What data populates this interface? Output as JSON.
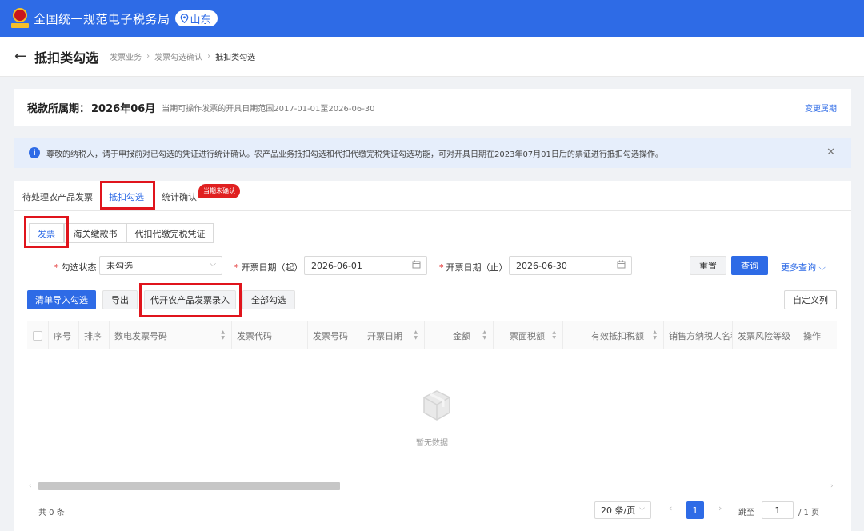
{
  "header": {
    "site_title": "全国统一规范电子税务局",
    "region": "山东"
  },
  "page": {
    "title": "抵扣类勾选",
    "breadcrumbs": [
      "发票业务",
      "发票勾选确认",
      "抵扣类勾选"
    ]
  },
  "period": {
    "label": "税款所属期：",
    "value": "2026年06月",
    "range_text": "当期可操作发票的开具日期范围2017-01-01至2026-06-30",
    "change_label": "变更属期"
  },
  "notice": {
    "text": "尊敬的纳税人，请于申报前对已勾选的凭证进行统计确认。农产品业务抵扣勾选和代扣代缴完税凭证勾选功能，可对开具日期在2023年07月01日后的票证进行抵扣勾选操作。"
  },
  "tabs": {
    "items": [
      "待处理农产品发票",
      "抵扣勾选",
      "统计确认"
    ],
    "active_index": 1,
    "badge": "当期未确认"
  },
  "subtabs": {
    "items": [
      "发票",
      "海关缴款书",
      "代扣代缴完税凭证"
    ],
    "active_index": 0
  },
  "filters": {
    "status_label": "勾选状态",
    "status_value": "未勾选",
    "start_label": "开票日期（起）",
    "start_value": "2026-06-01",
    "end_label": "开票日期（止）",
    "end_value": "2026-06-30",
    "reset_label": "重置",
    "query_label": "查询",
    "more_label": "更多查询"
  },
  "toolbar": {
    "import_label": "清单导入勾选",
    "export_label": "导出",
    "agri_entry_label": "代开农产品发票录入",
    "select_all_label": "全部勾选",
    "custom_columns_label": "自定义列"
  },
  "table": {
    "columns": [
      "序号",
      "排序",
      "数电发票号码",
      "发票代码",
      "发票号码",
      "开票日期",
      "金额",
      "票面税额",
      "有效抵扣税额",
      "销售方纳税人名称",
      "发票风险等级",
      "操作"
    ],
    "empty_text": "暂无数据",
    "scroll_position": 0.0
  },
  "pagination": {
    "total_text": "共 0 条",
    "page_size": "20 条/页",
    "current_page": "1",
    "jump_label": "跳至",
    "jump_value": "1",
    "pages_text": "/ 1 页"
  },
  "colors": {
    "brand": "#2e6be6",
    "highlight": "#e0141c",
    "badge": "#e02020"
  },
  "icons": [
    "emblem-icon",
    "location-pin-icon",
    "back-arrow-icon",
    "info-icon",
    "close-icon",
    "calendar-icon",
    "chevron-down-icon",
    "sort-icon",
    "empty-box-icon",
    "chevron-left-icon",
    "chevron-right-icon"
  ]
}
